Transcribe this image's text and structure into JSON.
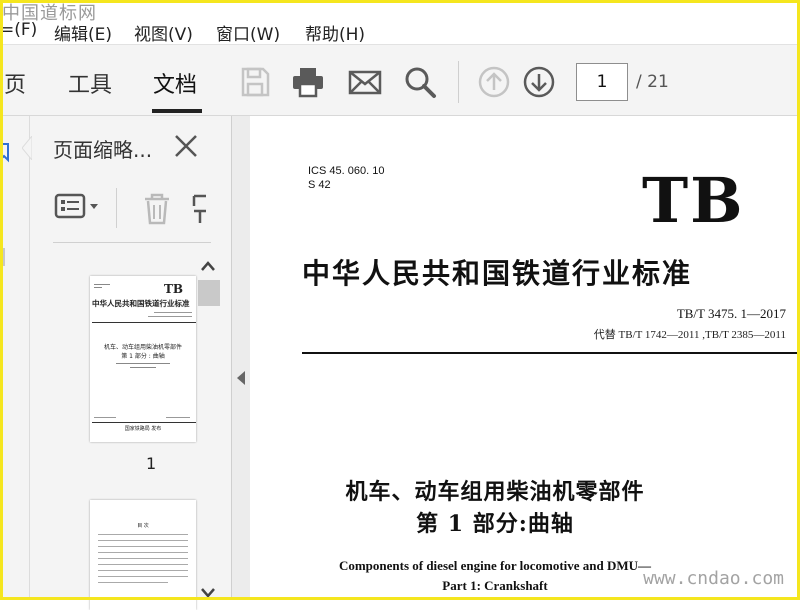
{
  "watermark_top": "中国道标网",
  "watermark_bottom": "www.cndao.com",
  "menu": {
    "file": "=(F)",
    "edit": "编辑(E)",
    "view": "视图(V)",
    "window": "窗口(W)",
    "help": "帮助(H)"
  },
  "tabs": {
    "home": "页",
    "tools": "工具",
    "document": "文档"
  },
  "toolbar": {
    "icons": [
      "save-icon",
      "print-icon",
      "mail-icon",
      "search-icon",
      "prev-page-icon",
      "next-page-icon"
    ],
    "page_current": "1",
    "page_total": "/ 21"
  },
  "panel": {
    "title": "页面缩略...",
    "thumbnail_1_label": "1"
  },
  "thumbnail_1": {
    "tb": "TB",
    "title": "中华人民共和国铁道行业标准",
    "h1": "机车、动车组用柴油机零部件",
    "h2": "第 1 部分 : 曲轴",
    "footer": "国家铁路局  发布"
  },
  "thumbnail_2": {
    "heading": "目  次"
  },
  "document": {
    "ics": "ICS 45. 060. 10",
    "s42": "S 42",
    "tb": "TB",
    "title": "中华人民共和国铁道行业标准",
    "code": "TB/T  3475. 1—2017",
    "replaces": "代替 TB/T 1742—2011 ,TB/T 2385—2011",
    "heading1": "机车、动车组用柴油机零部件",
    "heading2": "第 1 部分:曲轴",
    "en1": "Components of diesel engine for locomotive and DMU—",
    "en2": "Part 1: Crankshaft"
  },
  "colors": {
    "frame": "#f5e61e",
    "toolbar_bg": "#f4f4f4",
    "icon_gray": "#5a5a5a",
    "icon_disabled": "#c4c4c4"
  }
}
